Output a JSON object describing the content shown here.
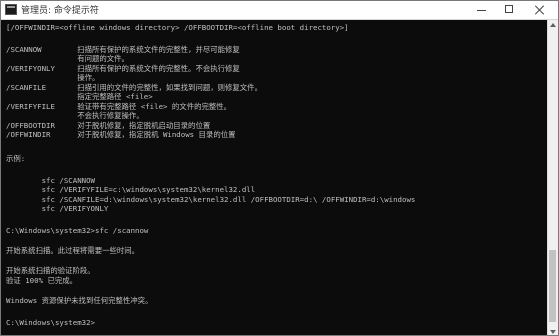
{
  "window": {
    "title": "管理员: 命令提示符",
    "icon": "cmd-icon"
  },
  "console_lines": [
    "[/OFFWINDIR=<offline windows directory> /OFFBOOTDIR=<offline boot directory>]",
    "/SCANNOW        扫描所有保护的系统文件的完整性，并尽可能修复",
    "                有问题的文件。",
    "/VERIFYONLY     扫描所有保护的系统文件的完整性。不会执行修复",
    "                操作。",
    "/SCANFILE       扫描引用的文件的完整性，如果找到问题，则修复文件。",
    "                指定完整路径 <file>",
    "/VERIFYFILE     验证带有完整路径 <file> 的文件的完整性。",
    "                不会执行修复操作。",
    "/OFFBOOTDIR     对于脱机修复，指定脱机启动目录的位置",
    "/OFFWINDIR      对于脱机修复，指定脱机 Windows 目录的位置",
    "示例:",
    "        sfc /SCANNOW",
    "        sfc /VERIFYFILE=c:\\windows\\system32\\kernel32.dll",
    "        sfc /SCANFILE=d:\\windows\\system32\\kernel32.dll /OFFBOOTDIR=d:\\ /OFFWINDIR=d:\\windows",
    "        sfc /VERIFYONLY",
    "C:\\Windows\\system32>sfc /scannow",
    "开始系统扫描。此过程将需要一些时间。",
    "开始系统扫描的验证阶段。",
    "验证 100% 已完成。",
    "Windows 资源保护未找到任何完整性冲突。",
    "C:\\Windows\\system32>"
  ],
  "colors": {
    "console_background": "#0c0c0c",
    "console_text": "#c0c0c0",
    "titlebar_background": "#ffffff"
  }
}
